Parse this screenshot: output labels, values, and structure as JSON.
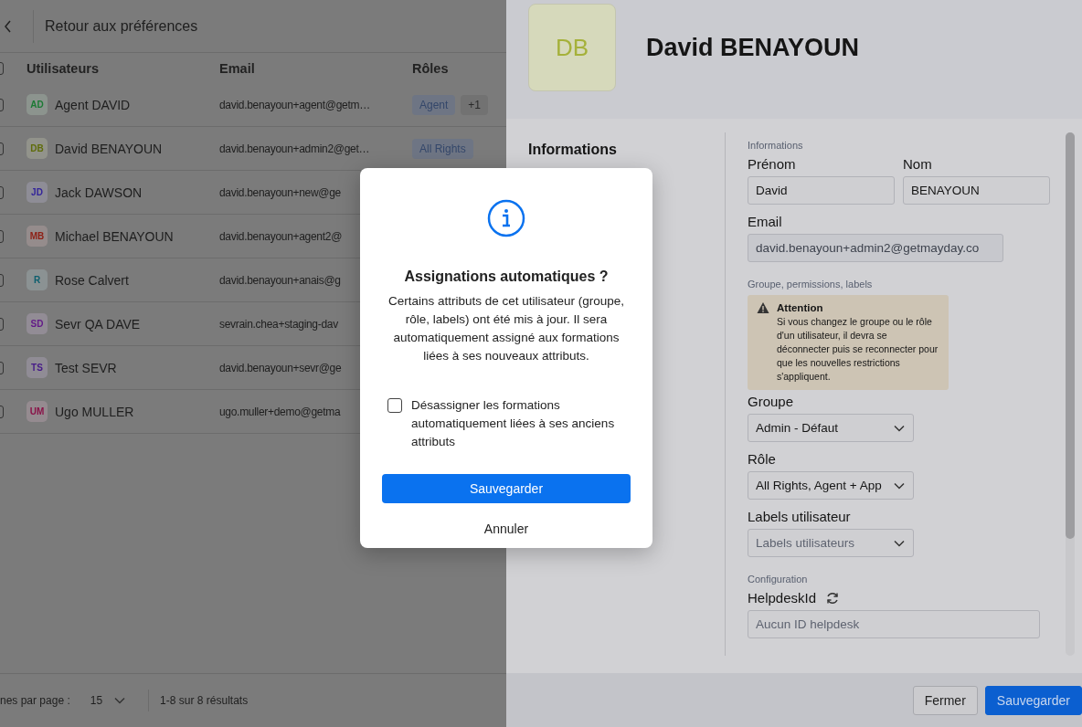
{
  "back_link": {
    "label": "Retour aux préférences"
  },
  "users_table": {
    "select_all": {
      "checked": false
    },
    "columns": [
      "Utilisateurs",
      "Email",
      "Rôles"
    ],
    "rows": [
      {
        "checked": false,
        "initials": "AD",
        "color": "#1b7a34",
        "name": "Agent DAVID",
        "email": "david.benayoun+agent@getm…",
        "roles": [
          {
            "label": "Agent",
            "kind": "role"
          },
          {
            "label": "+1",
            "kind": "more"
          }
        ]
      },
      {
        "checked": false,
        "initials": "DB",
        "color": "#5f6c0a",
        "name": "David BENAYOUN",
        "email": "david.benayoun+admin2@get…",
        "roles": [
          {
            "label": "All Rights",
            "kind": "role"
          }
        ]
      },
      {
        "checked": false,
        "initials": "JD",
        "color": "#33249a",
        "name": "Jack DAWSON",
        "email": "david.benayoun+new@ge",
        "roles": []
      },
      {
        "checked": false,
        "initials": "MB",
        "color": "#8e1f14",
        "name": "Michael BENAYOUN",
        "email": "david.benayoun+agent2@",
        "roles": []
      },
      {
        "checked": false,
        "initials": "R",
        "color": "#0d5f6e",
        "name": "Rose Calvert",
        "email": "david.benayoun+anais@g",
        "roles": []
      },
      {
        "checked": false,
        "initials": "SD",
        "color": "#631a88",
        "name": "Sevr QA DAVE",
        "email": "sevrain.chea+staging-dav",
        "roles": []
      },
      {
        "checked": false,
        "initials": "TS",
        "color": "#461a88",
        "name": "Test SEVR",
        "email": "david.benayoun+sevr@ge",
        "roles": []
      },
      {
        "checked": false,
        "initials": "UM",
        "color": "#8a1248",
        "name": "Ugo MULLER",
        "email": "ugo.muller+demo@getma",
        "roles": []
      }
    ]
  },
  "pagination": {
    "per_page_label": "nes par page :",
    "per_page": "15",
    "results": "1-8 sur 8 résultats"
  },
  "user_panel": {
    "initials": "DB",
    "name": "David BENAYOUN",
    "nav_item": "Informations",
    "sections": [
      {
        "title": "Informations",
        "fields": [
          {
            "kind": "text",
            "label": "Prénom",
            "value": "David"
          },
          {
            "kind": "text",
            "label": "Nom",
            "value": "BENAYOUN"
          },
          {
            "kind": "disabled",
            "label": "Email",
            "value": "david.benayoun+admin2@getmayday.co"
          }
        ]
      },
      {
        "title": "Groupe, permissions, labels",
        "alert": {
          "title": "Attention",
          "text": "Si vous changez le groupe ou le rôle d'un utilisateur, il devra se déconnecter puis se reconnecter pour que les nouvelles restrictions s'appliquent."
        },
        "fields": [
          {
            "kind": "select",
            "label": "Groupe",
            "value": "Admin - Défaut"
          },
          {
            "kind": "select",
            "label": "Rôle",
            "value": "All Rights, Agent + App"
          },
          {
            "kind": "select",
            "label": "Labels utilisateur",
            "placeholder": "Labels utilisateurs"
          }
        ]
      },
      {
        "title": "Configuration",
        "fields": [
          {
            "kind": "refresh",
            "label": "HelpdeskId",
            "placeholder": "Aucun ID helpdesk"
          }
        ]
      }
    ],
    "footer_buttons": [
      {
        "label": "Fermer",
        "kind": "secondary"
      },
      {
        "label": "Sauvegarder",
        "kind": "primary"
      }
    ]
  },
  "dialog": {
    "title": "Assignations automatiques ?",
    "message": "Certains attributs de cet utilisateur (groupe, rôle, labels) ont été mis à jour. Il sera automatiquement assigné aux formations liées à ses nouveaux attributs.",
    "option": {
      "label": "Désassigner les formations automatiquement liées à ses anciens attributs",
      "checked": false
    },
    "confirm": "Sauvegarder",
    "cancel": "Annuler"
  }
}
